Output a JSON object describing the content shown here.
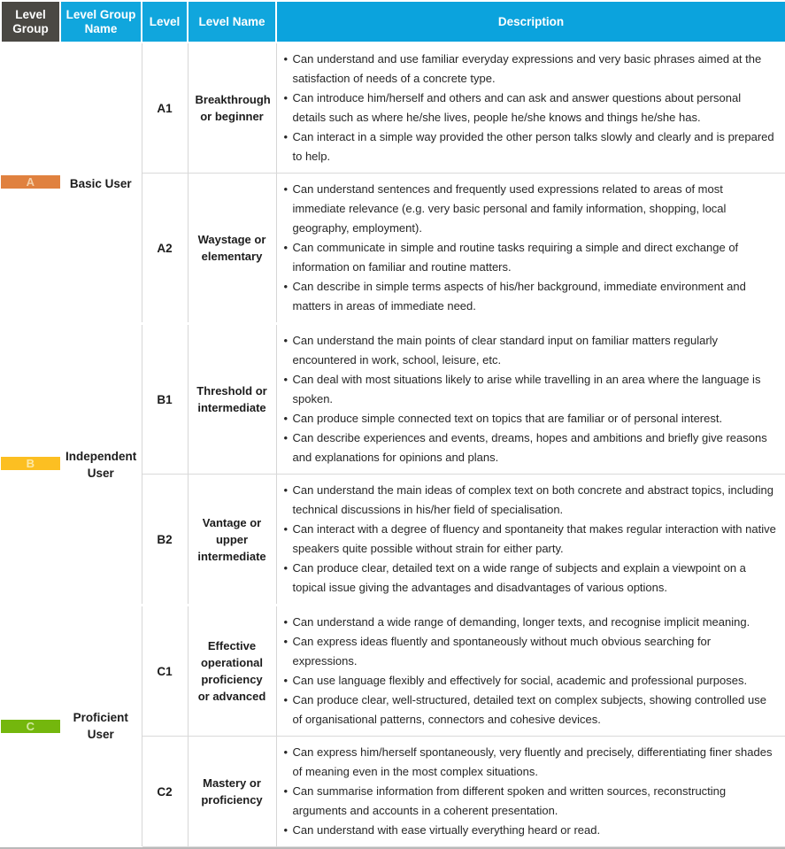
{
  "table": {
    "headers": {
      "level_group": "Level Group",
      "level_group_name": "Level Group Name",
      "level": "Level",
      "level_name": "Level Name",
      "description": "Description"
    },
    "colors": {
      "header_dark": "#4a4843",
      "header_cyan": "#10a6dd",
      "group_a": "#e0813f",
      "group_b": "#fcbf22",
      "group_c": "#74b70d",
      "group_a_text": "#f3cfa9",
      "group_b_text": "#fde9a8",
      "group_c_text": "#d2e9a0"
    },
    "groups": [
      {
        "code": "A",
        "name": "Basic User",
        "levels": [
          {
            "level": "A1",
            "level_name": "Breakthrough or beginner",
            "bullets": [
              "Can understand and use familiar everyday expressions and very basic phrases aimed at the satisfaction of needs of a concrete type.",
              "Can introduce him/herself and others and can ask and answer questions about personal details such as where he/she lives, people he/she knows and things he/she has.",
              "Can interact in a simple way provided the other person talks slowly and clearly and is prepared to help."
            ]
          },
          {
            "level": "A2",
            "level_name": "Waystage or elementary",
            "bullets": [
              "Can understand sentences and frequently used expressions related to areas of most immediate relevance (e.g. very basic personal and family information, shopping, local geography, employment).",
              "Can communicate in simple and routine tasks requiring a simple and direct exchange of information on familiar and routine matters.",
              "Can describe in simple terms aspects of his/her background, immediate environment and matters in areas of immediate need."
            ]
          }
        ]
      },
      {
        "code": "B",
        "name": "Independent User",
        "levels": [
          {
            "level": "B1",
            "level_name": "Threshold or intermediate",
            "bullets": [
              "Can understand the main points of clear standard input on familiar matters regularly encountered in work, school, leisure, etc.",
              "Can deal with most situations likely to arise while travelling in an area where the language is spoken.",
              "Can produce simple connected text on topics that are familiar or of personal interest.",
              "Can describe experiences and events, dreams, hopes and ambitions and briefly give reasons and explanations for opinions and plans."
            ]
          },
          {
            "level": "B2",
            "level_name": "Vantage or upper intermediate",
            "bullets": [
              "Can understand the main ideas of complex text on both concrete and abstract topics, including technical discussions in his/her field of specialisation.",
              "Can interact with a degree of fluency and spontaneity that makes regular interaction with native speakers quite possible without strain for either party.",
              "Can produce clear, detailed text on a wide range of subjects and explain a viewpoint on a topical issue giving the advantages and disadvantages of various options."
            ]
          }
        ]
      },
      {
        "code": "C",
        "name": "Proficient User",
        "levels": [
          {
            "level": "C1",
            "level_name": "Effective operational proficiency or advanced",
            "bullets": [
              "Can understand a wide range of demanding, longer texts, and recognise implicit meaning.",
              "Can express ideas fluently and spontaneously without much obvious searching for expressions.",
              "Can use language flexibly and effectively for social, academic and professional purposes.",
              "Can produce clear, well-structured, detailed text on complex subjects, showing controlled use of organisational patterns, connectors and cohesive devices."
            ]
          },
          {
            "level": "C2",
            "level_name": "Mastery or proficiency",
            "bullets": [
              "Can express him/herself spontaneously, very fluently and precisely, differentiating finer shades of meaning even in the most complex situations.",
              "Can summarise information from different spoken and written sources, reconstructing arguments and accounts in a coherent presentation.",
              "Can understand with ease virtually everything heard or read."
            ]
          }
        ]
      }
    ]
  }
}
